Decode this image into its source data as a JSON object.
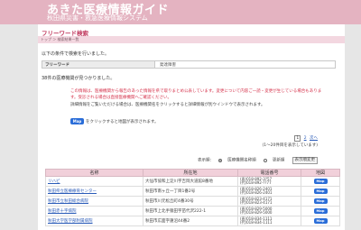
{
  "header": {
    "title": "あきた医療情報ガイド",
    "subtitle": "秋田県災害・救急医療情報システム"
  },
  "section": {
    "title": "フリーワード検索",
    "breadcrumb": "トップ ＞ 検索結果一覧"
  },
  "conditions": {
    "intro": "以下の条件で検索を行いました。",
    "label": "フリーワード",
    "value": "発達障害"
  },
  "results_info": {
    "count_text": "38件の医療機関が見つかりました。",
    "notice_red": "この情報は、医療機関から報告のあった情報を県で取りまとめ公表しています。変更について内容ご一読・変更が生じている場合もあります。受診される場合は直接医療機関へご確認ください。",
    "notice_detail": "詳細情報をご覧いただける場合は、医療機関名をクリックすると詳細情報が別ウインドウで表示されます。",
    "map_button": "Map",
    "map_hint": "をクリックすると地図が表示されます。"
  },
  "pager": {
    "current": "1",
    "pages": [
      "2",
      "次へ"
    ],
    "range": "(1～20件目を表示しています)"
  },
  "order": {
    "label": "表示順:",
    "options": [
      "医療機関名称順",
      "更新順"
    ],
    "selected": "医療機関名称順",
    "button": "表示順変更"
  },
  "table": {
    "headers": [
      "名称",
      "所在地",
      "電話番号",
      "地図"
    ],
    "rows": [
      {
        "name": "リハビ",
        "address": "大仙市協和上淀川字吉岡大道館8番地",
        "tel1": "(直)018-892-3?57",
        "tel2": "(代)018-892-??77",
        "map": "Map"
      },
      {
        "name": "秋田県立医療療育センター",
        "address": "秋田市南ヶ丘一丁目1番2号",
        "tel1": "(直)018-826-2401",
        "tel2": "(代)018-826-2401",
        "map": "Map"
      },
      {
        "name": "秋田市立秋田総合病院",
        "address": "秋田市川元松丘町4番30号",
        "tel1": "(直)018-823-4171",
        "tel2": "(代)018-823-4171",
        "map": "Map"
      },
      {
        "name": "秋田赤十字病院",
        "address": "秋田市上北手猿田字苗代沢222-1",
        "tel1": "(直)018-829-5000",
        "tel2": "(代)018-829-5000",
        "map": "Map"
      },
      {
        "name": "秋田大学医学部附属病院",
        "address": "秋田市広面字蓮沼44番2",
        "tel1": "(直)018-834-1111",
        "tel2": "(代)018-834-1111",
        "map": "Map"
      }
    ]
  }
}
